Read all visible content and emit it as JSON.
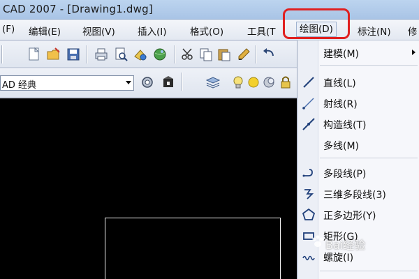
{
  "window": {
    "title": "CAD 2007 - [Drawing1.dwg]"
  },
  "menubar": {
    "items": [
      {
        "label": "(F)"
      },
      {
        "label": "编辑(E)"
      },
      {
        "label": "视图(V)"
      },
      {
        "label": "插入(I)"
      },
      {
        "label": "格式(O)"
      },
      {
        "label": "工具(T"
      },
      {
        "label": "绘图(D)"
      },
      {
        "label": "标注(N)"
      },
      {
        "label": "修"
      }
    ],
    "active_index": 6,
    "highlight_color": "#e02020"
  },
  "toolbar": {
    "workspace_value": "AD 经典"
  },
  "draw_menu": {
    "items": [
      {
        "label": "建模(M)",
        "icon": "none",
        "submenu": true
      },
      {
        "label": "直线(L)",
        "icon": "line-icon"
      },
      {
        "label": "射线(R)",
        "icon": "ray-icon"
      },
      {
        "label": "构造线(T)",
        "icon": "construction-line-icon"
      },
      {
        "label": "多线(M)",
        "icon": "none"
      },
      {
        "label": "多段线(P)",
        "icon": "polyline-icon"
      },
      {
        "label": "三维多段线(3)",
        "icon": "3d-polyline-icon"
      },
      {
        "label": "正多边形(Y)",
        "icon": "polygon-icon"
      },
      {
        "label": "矩形(G)",
        "icon": "rectangle-icon"
      },
      {
        "label": "螺旋(I)",
        "icon": "helix-icon"
      }
    ]
  },
  "watermark": {
    "text": "Bai经验"
  }
}
